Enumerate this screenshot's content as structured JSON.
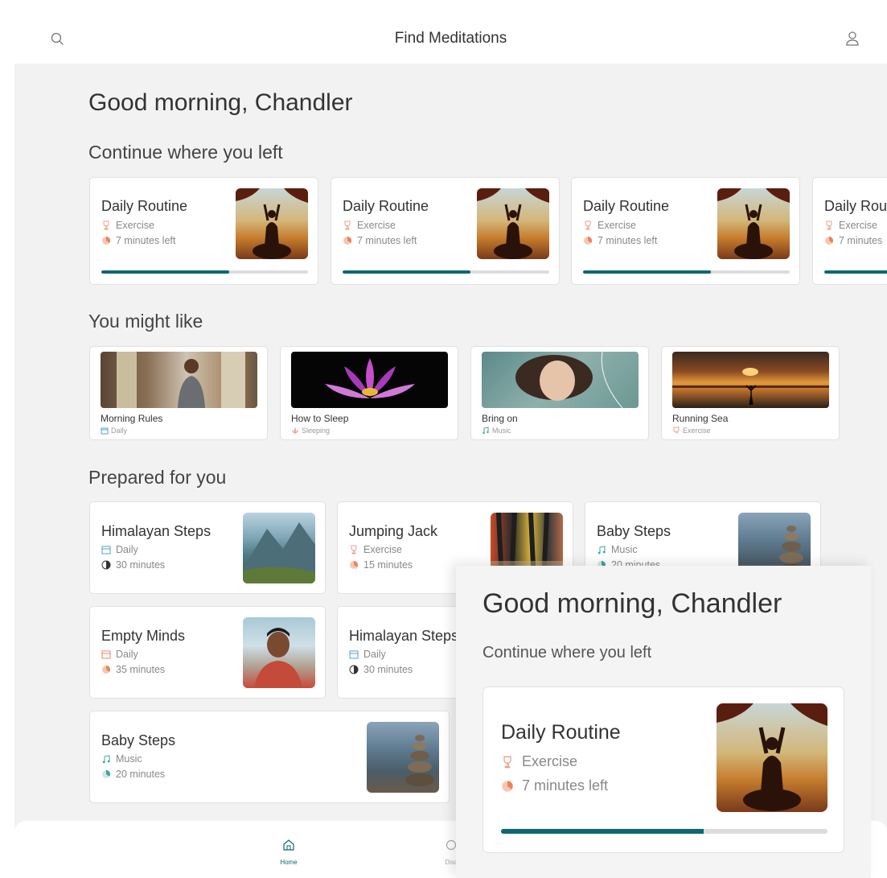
{
  "header": {
    "title": "Find Meditations",
    "search_icon": "search-icon",
    "profile_icon": "user-icon"
  },
  "greeting": "Good morning, Chandler",
  "continue": {
    "title": "Continue where you left",
    "items": [
      {
        "name": "Daily Routine",
        "category": "Exercise",
        "time": "7 minutes left",
        "progress": 0.62
      },
      {
        "name": "Daily Routine",
        "category": "Exercise",
        "time": "7 minutes left",
        "progress": 0.62
      },
      {
        "name": "Daily Routine",
        "category": "Exercise",
        "time": "7 minutes left",
        "progress": 0.62
      },
      {
        "name": "Daily Rou",
        "category": "Exercise",
        "time": "7 minutes",
        "progress": 0.62
      }
    ]
  },
  "like": {
    "title": "You might like",
    "items": [
      {
        "name": "Morning Rules",
        "category": "Daily"
      },
      {
        "name": "How to Sleep",
        "category": "Sleeping"
      },
      {
        "name": "Bring on",
        "category": "Music"
      },
      {
        "name": "Running Sea",
        "category": "Exercise"
      }
    ]
  },
  "prepared": {
    "title": "Prepared for you",
    "items": [
      {
        "name": "Himalayan Steps",
        "category": "Daily",
        "time": "30 minutes"
      },
      {
        "name": "Jumping Jack",
        "category": "Exercise",
        "time": "15 minutes"
      },
      {
        "name": "Baby Steps",
        "category": "Music",
        "time": "20 minutes"
      },
      {
        "name": "Empty Minds",
        "category": "Daily",
        "time": "35 minutes"
      },
      {
        "name": "Himalayan Steps",
        "category": "Daily",
        "time": "30 minutes"
      },
      {
        "name": "Baby Steps",
        "category": "Music",
        "time": "20 minutes"
      }
    ]
  },
  "nav": {
    "home": "Home",
    "discover": "Disc"
  },
  "zoom": {
    "greeting": "Good morning, Chandler",
    "subtitle": "Continue where you left",
    "card": {
      "name": "Daily Routine",
      "category": "Exercise",
      "time": "7 minutes left",
      "progress": 0.62
    }
  },
  "colors": {
    "accent": "#0f6770",
    "exercise": "#e8a08a",
    "daily": "#4fa3c7",
    "music": "#3fa3a0",
    "timer": "#e8845c"
  }
}
